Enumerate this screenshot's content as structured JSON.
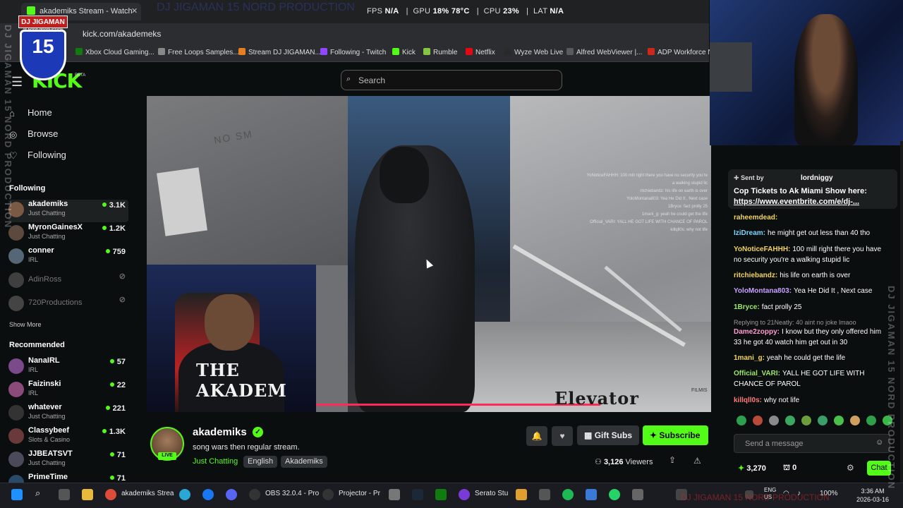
{
  "browser": {
    "tab_title": "akademiks Stream - Watch",
    "url": "kick.com/akademeks",
    "perf": {
      "fps_label": "FPS",
      "fps": "N/A",
      "gpu_label": "GPU",
      "gpu": "18% 78°C",
      "cpu_label": "CPU",
      "cpu": "23%",
      "lat_label": "LAT",
      "lat": "N/A"
    },
    "bookmarks": [
      "Xbox Cloud Gaming...",
      "Free Loops Samples...",
      "Stream DJ JIGAMAN...",
      "Following - Twitch",
      "Kick",
      "Rumble",
      "Netflix",
      "Wyze Web Live",
      "Alfred WebViewer |...",
      "ADP Workforce N"
    ]
  },
  "header": {
    "logo": "KICK",
    "beta": "BETA",
    "search_placeholder": "Search"
  },
  "sidebar": {
    "nav": [
      {
        "label": "Home",
        "icon": "home-icon"
      },
      {
        "label": "Browse",
        "icon": "compass-icon"
      },
      {
        "label": "Following",
        "icon": "heart-icon"
      }
    ],
    "following_heading": "Following",
    "following": [
      {
        "name": "akademiks",
        "sub": "Just Chatting",
        "viewers": "3.1K"
      },
      {
        "name": "MyronGainesX",
        "sub": "Just Chatting",
        "viewers": "1.2K"
      },
      {
        "name": "conner",
        "sub": "IRL",
        "viewers": "759"
      },
      {
        "name": "AdinRoss",
        "sub": "",
        "viewers": ""
      },
      {
        "name": "720Productions",
        "sub": "",
        "viewers": ""
      }
    ],
    "show_more": "Show More",
    "recommended_heading": "Recommended",
    "recommended": [
      {
        "name": "NanaIRL",
        "sub": "IRL",
        "viewers": "57"
      },
      {
        "name": "Faizinski",
        "sub": "IRL",
        "viewers": "22"
      },
      {
        "name": "whatever",
        "sub": "Just Chatting",
        "viewers": "221"
      },
      {
        "name": "Classybeef",
        "sub": "Slots & Casino",
        "viewers": "1.3K"
      },
      {
        "name": "JJBEATSVT",
        "sub": "Just Chatting",
        "viewers": "71"
      },
      {
        "name": "PrimeTime",
        "sub": "",
        "viewers": "71"
      }
    ]
  },
  "video": {
    "sign_text": "NO SM",
    "facecam_shirt": "THE AKADEM",
    "caption": "Elevator",
    "watermark": "FILMIS",
    "overlay_chat": [
      "YoNoticeFAHHH: 100 mill right there you have no security you're",
      "a walking stupid lic",
      "ritchiebandz: his life on earth is over",
      "YoloMontana803: Yea He Did It , Next case",
      "1Bryce: fact prolly 25",
      "1mani_g: yeah he could get the life",
      "Official_VARI: YALL HE GOT LIFE WITH CHANCE OF PAROL",
      "killqll0s: why not life"
    ],
    "progress": 0.72
  },
  "stream": {
    "channel": "akademiks",
    "live_label": "LIVE",
    "title": "song wars then regular stream.",
    "category": "Just Chatting",
    "tags": [
      "English",
      "Akademiks"
    ],
    "gift_subs": "Gift Subs",
    "subscribe": "Subscribe",
    "viewers": "3,126",
    "viewers_label": "Viewers"
  },
  "chat": {
    "pinned_sent_by": "Sent by",
    "pinned_user": "lordniggy",
    "pinned_text": "Cop Tickets to Ak Miami Show here:",
    "pinned_link": "https://www.eventbrite.com/e/dj-...",
    "messages": [
      {
        "user": "raheemdead:",
        "text": "",
        "color": "#f4d35e"
      },
      {
        "user": "IziDream:",
        "text": "he might get out less than 40 tho",
        "color": "#7cd4ff"
      },
      {
        "user": "YoNoticeFAHHH:",
        "text": "100 mill right there you have no security you're a walking stupid lic",
        "color": "#f4d35e"
      },
      {
        "user": "ritchiebandz:",
        "text": "his life on earth is over",
        "color": "#f4d35e"
      },
      {
        "user": "YoloMontana803:",
        "text": "Yea He Did It , Next case",
        "color": "#c8a2ff"
      },
      {
        "user": "1Bryce:",
        "text": "fact prolly 25",
        "color": "#9be86a"
      },
      {
        "reply": "Replying to 21Neatly: 40 aint no joke lmaoo"
      },
      {
        "user": "Dame2zoppy:",
        "text": "I know but they only offered him 33 he got 40 watch him get out in 30",
        "color": "#ff9bd0"
      },
      {
        "user": "1mani_g:",
        "text": "yeah he could get the life",
        "color": "#f4d35e"
      },
      {
        "user": "Official_VARI:",
        "text": "YALL HE GOT LIFE WITH CHANCE OF PAROL",
        "color": "#9be86a"
      },
      {
        "user": "killqll0s:",
        "text": "why not life",
        "color": "#ff7b7b"
      }
    ],
    "input_placeholder": "Send a message",
    "points": "3,270",
    "zero": "0",
    "chat_button": "Chat"
  },
  "taskbar": {
    "items": [
      "akademiks Strea",
      "OBS 32.0.4 - Pro",
      "Projector - Pr",
      "Serato Stu"
    ],
    "lang1": "ENG",
    "lang2": "US",
    "battery": "100%",
    "time": "3:36 AM",
    "date": "2026-03-16"
  },
  "overlay": {
    "badge_top": "DJ JIGAMAN",
    "badge_sub": "15 NORD PRODUCTION",
    "badge_number": "15",
    "wm_vertical": "DJ JIGAMAN 15 NORD PRODUCTION",
    "wm_top": "DJ JIGAMAN 15 NORD PRODUCTION",
    "wm_bottom": "DJ JIGAMAN 15 NORD PRODUCTION"
  }
}
